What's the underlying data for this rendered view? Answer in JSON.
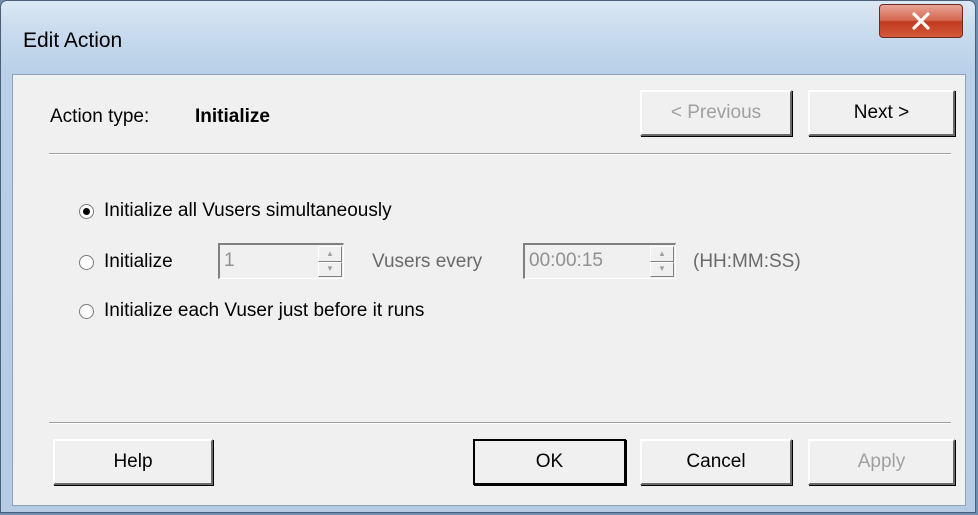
{
  "window": {
    "title": "Edit Action",
    "close_icon": "close-icon"
  },
  "header": {
    "action_type_label": "Action type:",
    "action_type_value": "Initialize",
    "previous_label": "< Previous",
    "next_label": "Next >"
  },
  "options": {
    "selected": 0,
    "all_simultaneously_label": "Initialize  all Vusers  simultaneously",
    "initialize_label": "Initialize",
    "vusers_count": "1",
    "vusers_every_label": "Vusers every",
    "interval": "00:00:15",
    "interval_format": "(HH:MM:SS)",
    "each_before_run_label": "Initialize  each Vuser just before it runs"
  },
  "footer": {
    "help_label": "Help",
    "ok_label": "OK",
    "cancel_label": "Cancel",
    "apply_label": "Apply"
  }
}
